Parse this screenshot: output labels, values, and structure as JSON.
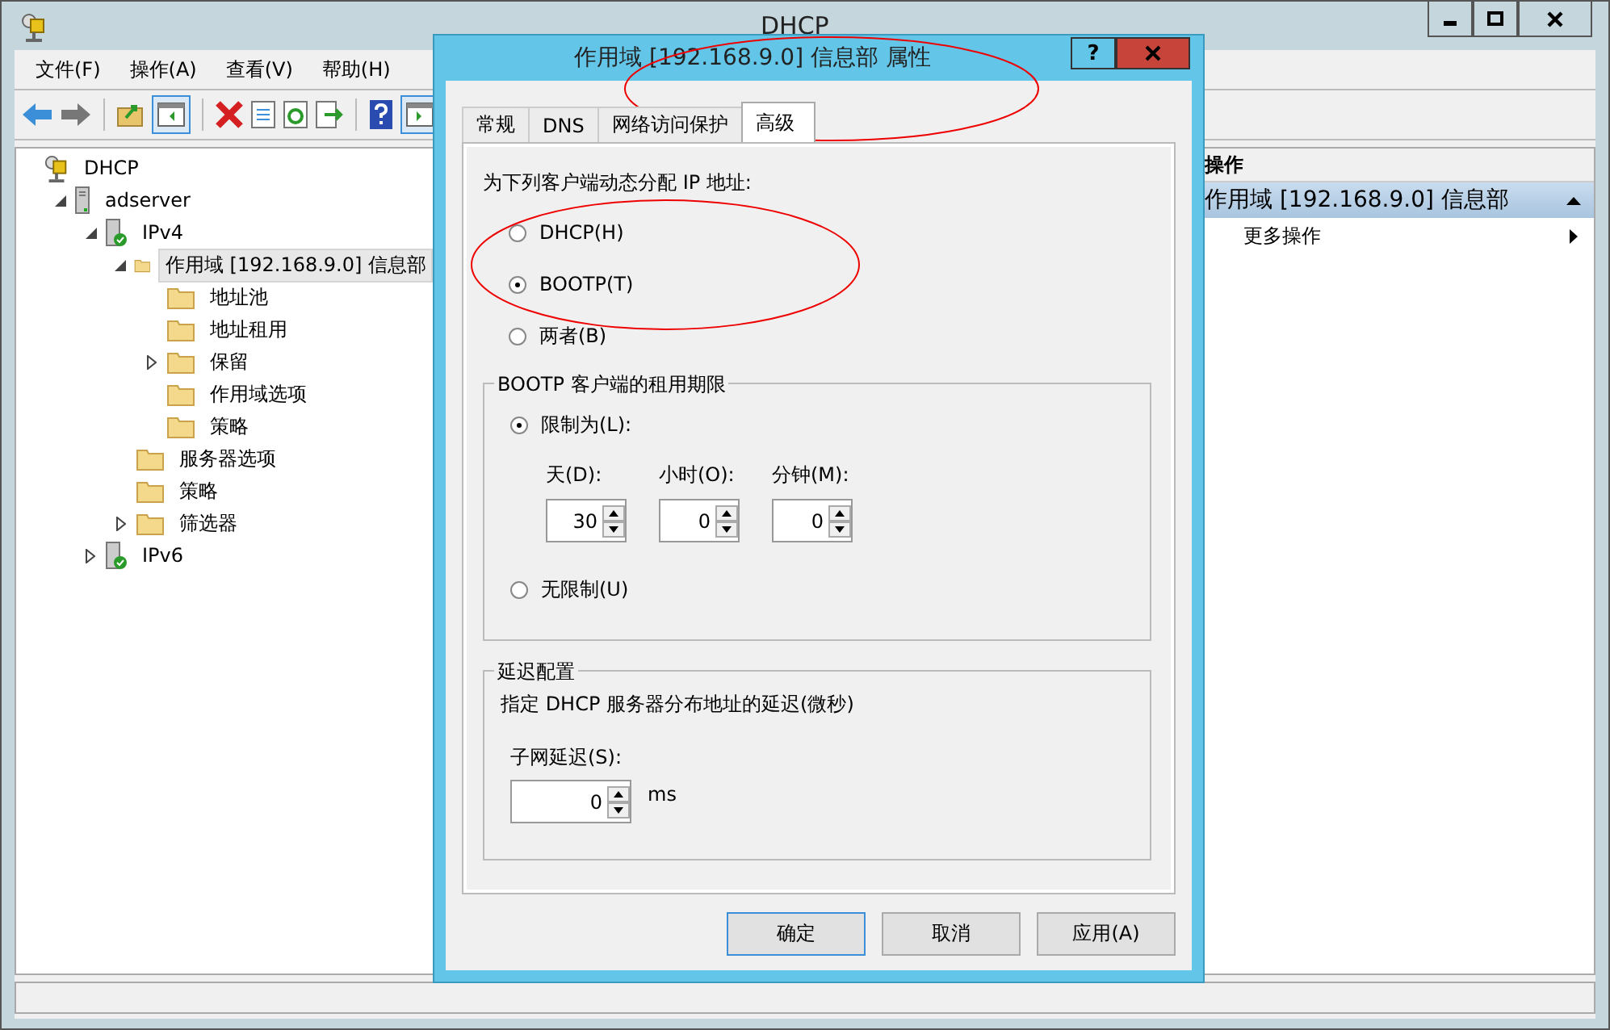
{
  "window": {
    "title": "DHCP"
  },
  "menu": [
    "文件(F)",
    "操作(A)",
    "查看(V)",
    "帮助(H)"
  ],
  "tree": [
    {
      "label": "DHCP",
      "kind": "dhcp",
      "selected": false,
      "children": [
        {
          "label": "adserver",
          "kind": "server",
          "selected": false,
          "expanded": true,
          "children": [
            {
              "label": "IPv4",
              "kind": "ipv",
              "selected": false,
              "expanded": true,
              "children": [
                {
                  "label": "作用域 [192.168.9.0] 信息部",
                  "kind": "folder",
                  "selected": true,
                  "expanded": true,
                  "children": [
                    {
                      "label": "地址池",
                      "kind": "folder",
                      "selected": false
                    },
                    {
                      "label": "地址租用",
                      "kind": "folder",
                      "selected": false
                    },
                    {
                      "label": "保留",
                      "kind": "folder",
                      "selected": false,
                      "expanded": false
                    },
                    {
                      "label": "作用域选项",
                      "kind": "folder",
                      "selected": false
                    },
                    {
                      "label": "策略",
                      "kind": "folder",
                      "selected": false
                    }
                  ]
                },
                {
                  "label": "服务器选项",
                  "kind": "folder",
                  "selected": false
                },
                {
                  "label": "策略",
                  "kind": "folder",
                  "selected": false
                },
                {
                  "label": "筛选器",
                  "kind": "folder",
                  "selected": false,
                  "expanded": false
                }
              ]
            },
            {
              "label": "IPv6",
              "kind": "ipv",
              "selected": false,
              "expanded": false
            }
          ]
        }
      ]
    }
  ],
  "actions": {
    "header": "操作",
    "section": "作用域 [192.168.9.0] 信息部",
    "items": [
      "更多操作"
    ]
  },
  "dialog": {
    "title": "作用域 [192.168.9.0] 信息部 属性",
    "help": "?",
    "tabs": [
      {
        "label": "常规",
        "selected": false
      },
      {
        "label": "DNS",
        "selected": false
      },
      {
        "label": "网络访问保护",
        "selected": false
      },
      {
        "label": "高级",
        "selected": true
      }
    ],
    "assign_label": "为下列客户端动态分配 IP 地址:",
    "assign_options": [
      {
        "label": "DHCP(H)",
        "selected": false
      },
      {
        "label": "BOOTP(T)",
        "selected": true
      },
      {
        "label": "两者(B)",
        "selected": false
      }
    ],
    "lease": {
      "legend": "BOOTP 客户端的租用期限",
      "options": [
        {
          "label": "限制为(L):",
          "selected": true
        },
        {
          "label": "无限制(U)",
          "selected": false
        }
      ],
      "spinners": [
        {
          "label": "天(D):",
          "value": "30"
        },
        {
          "label": "小时(O):",
          "value": "0"
        },
        {
          "label": "分钟(M):",
          "value": "0"
        }
      ]
    },
    "delay": {
      "legend": "延迟配置",
      "description": "指定 DHCP 服务器分布地址的延迟(微秒)",
      "label": "子网延迟(S):",
      "value": "0",
      "unit": "ms"
    },
    "buttons": [
      {
        "label": "确定",
        "default": true
      },
      {
        "label": "取消",
        "default": false
      },
      {
        "label": "应用(A)",
        "default": false
      }
    ]
  },
  "markup": [
    {
      "kind": "ellipse"
    },
    {
      "kind": "ellipse"
    }
  ]
}
